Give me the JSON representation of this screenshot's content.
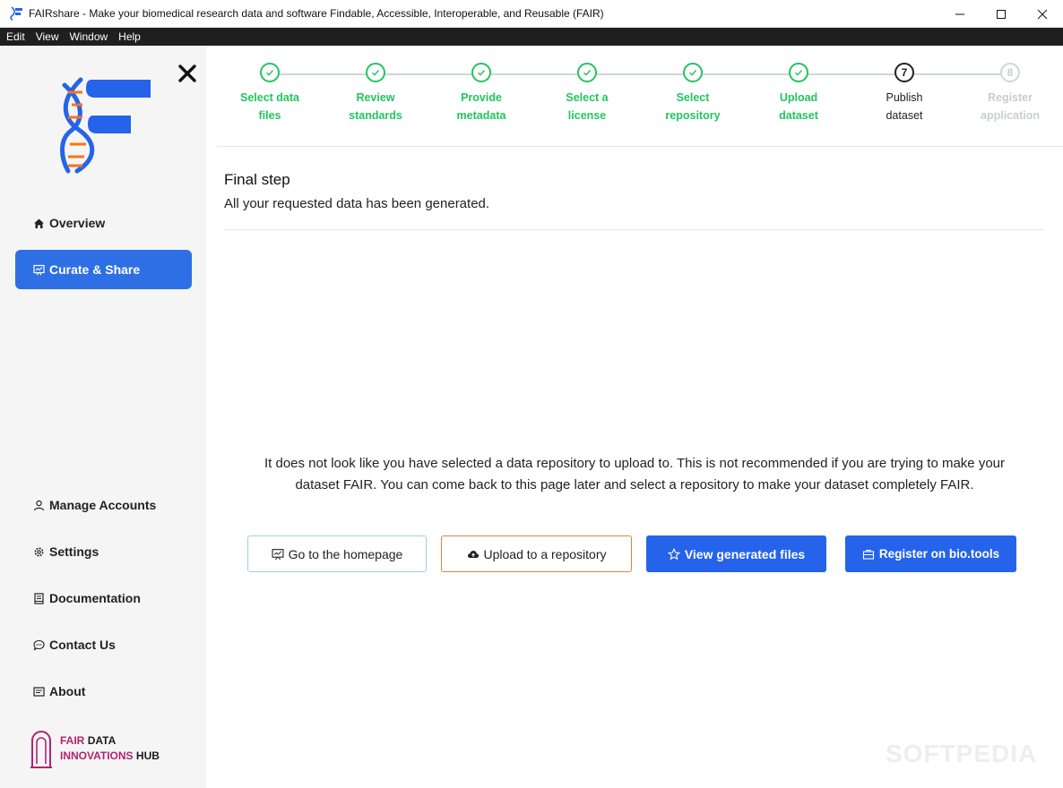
{
  "window": {
    "title": "FAIRshare - Make your biomedical research data and software Findable, Accessible, Interoperable, and Reusable (FAIR)"
  },
  "menu": [
    "Edit",
    "View",
    "Window",
    "Help"
  ],
  "sidebar": {
    "nav_top": [
      {
        "label": "Overview",
        "icon": "home-icon"
      },
      {
        "label": "Curate & Share",
        "icon": "curate-icon",
        "active": true
      }
    ],
    "nav_bottom": [
      {
        "label": "Manage Accounts",
        "icon": "user-icon"
      },
      {
        "label": "Settings",
        "icon": "gear-icon"
      },
      {
        "label": "Documentation",
        "icon": "book-icon"
      },
      {
        "label": "Contact Us",
        "icon": "chat-icon"
      },
      {
        "label": "About",
        "icon": "info-card-icon"
      }
    ],
    "footer_logo": {
      "line1_a": "FAIR",
      "line1_b": "DATA",
      "line2_a": "INNOVATIONS",
      "line2_b": "HUB"
    }
  },
  "steps": [
    {
      "line1": "Select data",
      "line2": "files",
      "status": "done"
    },
    {
      "line1": "Review",
      "line2": "standards",
      "status": "done"
    },
    {
      "line1": "Provide",
      "line2": "metadata",
      "status": "done"
    },
    {
      "line1": "Select a",
      "line2": "license",
      "status": "done"
    },
    {
      "line1": "Select",
      "line2": "repository",
      "status": "done"
    },
    {
      "line1": "Upload",
      "line2": "dataset",
      "status": "done"
    },
    {
      "number": "7",
      "line1": "Publish",
      "line2": "dataset",
      "status": "current"
    },
    {
      "number": "8",
      "line1": "Register",
      "line2": "application",
      "status": "pending"
    }
  ],
  "content": {
    "title": "Final step",
    "subtitle": "All your requested data has been generated.",
    "warning": "It does not look like you have selected a data repository to upload to. This is not recommended if you are trying to make your dataset FAIR. You can come back to this page later and select a repository to make your dataset completely FAIR."
  },
  "buttons": {
    "home": "Go to the homepage",
    "upload": "Upload to a repository",
    "view": "View generated files",
    "register": "Register on bio.tools"
  },
  "watermark": "SOFTPEDIA",
  "colors": {
    "primary": "#2563eb",
    "success": "#22c55e",
    "brand_pink": "#b1246f",
    "orange": "#e0823a"
  }
}
